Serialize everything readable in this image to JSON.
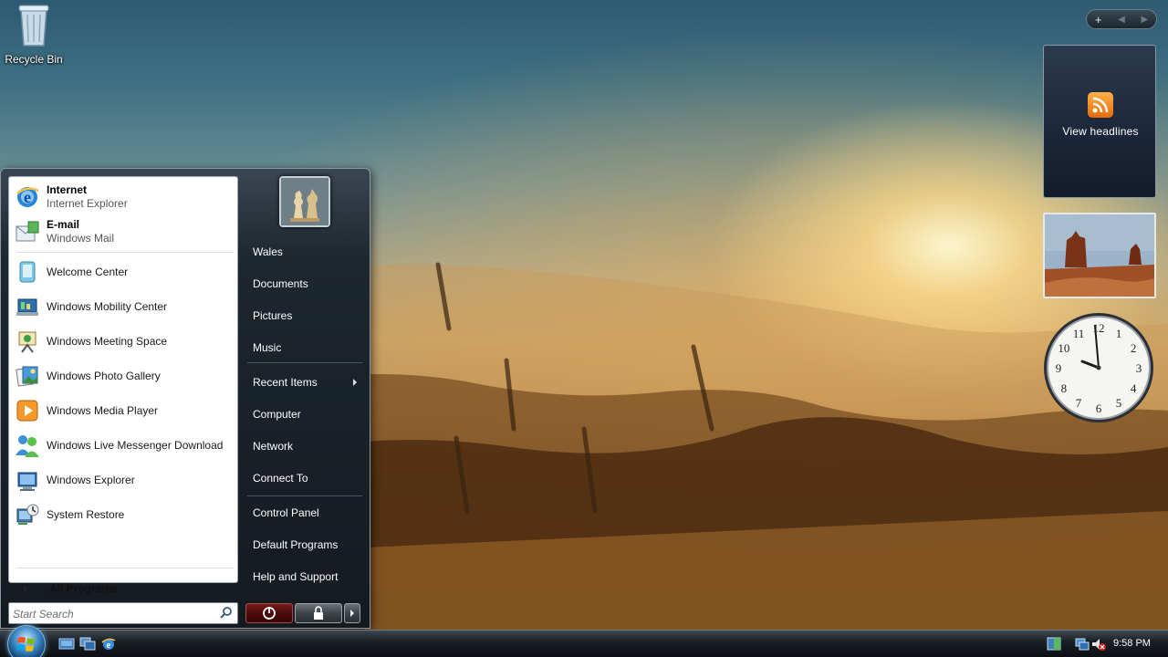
{
  "desktop": {
    "icons": [
      {
        "label": "Recycle Bin",
        "icon": "recycle-bin-icon"
      }
    ]
  },
  "sidebar": {
    "controls": {
      "add": "+",
      "prev": "◀",
      "next": "▶"
    },
    "feed_gadget": {
      "label": "View headlines",
      "icon": "rss-icon"
    },
    "clock_gadget": {
      "hours": [
        "12",
        "1",
        "2",
        "3",
        "4",
        "5",
        "6",
        "7",
        "8",
        "9",
        "10",
        "11"
      ]
    }
  },
  "start_menu": {
    "pinned": [
      {
        "title": "Internet",
        "subtitle": "Internet Explorer",
        "icon": "internet-explorer-icon"
      },
      {
        "title": "E-mail",
        "subtitle": "Windows Mail",
        "icon": "windows-mail-icon"
      }
    ],
    "recent": [
      {
        "label": "Welcome Center",
        "icon": "welcome-center-icon"
      },
      {
        "label": "Windows Mobility Center",
        "icon": "mobility-center-icon"
      },
      {
        "label": "Windows Meeting Space",
        "icon": "meeting-space-icon"
      },
      {
        "label": "Windows Photo Gallery",
        "icon": "photo-gallery-icon"
      },
      {
        "label": "Windows Media Player",
        "icon": "media-player-icon"
      },
      {
        "label": "Windows Live Messenger Download",
        "icon": "messenger-icon"
      },
      {
        "label": "Windows Explorer",
        "icon": "windows-explorer-icon"
      },
      {
        "label": "System Restore",
        "icon": "system-restore-icon"
      }
    ],
    "all_programs": "All Programs",
    "search_placeholder": "Start Search",
    "right_links": [
      "Wales",
      "Documents",
      "Pictures",
      "Music",
      "Recent Items",
      "Computer",
      "Network",
      "Connect To",
      "Control Panel",
      "Default Programs",
      "Help and Support"
    ]
  },
  "taskbar": {
    "clock": "9:58 PM",
    "quick_launch": [
      "show-desktop-icon",
      "switch-windows-icon",
      "internet-explorer-icon"
    ],
    "tray_icons": [
      "network-icon",
      "windows-sidebar-icon",
      "volume-muted-icon"
    ]
  },
  "colors": {
    "start_menu_dark": "#141a20",
    "left_pane": "#ffffff",
    "power_button": "#7a1b1b",
    "feed_accent": "#f08a1c"
  }
}
